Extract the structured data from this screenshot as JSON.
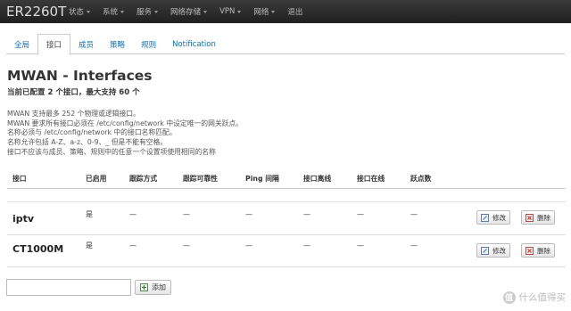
{
  "app": {
    "brand": "ER2260T",
    "menu": [
      "状态",
      "系统",
      "服务",
      "网络存储",
      "VPN",
      "网络",
      "退出"
    ]
  },
  "tabs": [
    {
      "label": "全局",
      "active": false
    },
    {
      "label": "接口",
      "active": true
    },
    {
      "label": "成员",
      "active": false
    },
    {
      "label": "策略",
      "active": false
    },
    {
      "label": "规则",
      "active": false
    },
    {
      "label": "Notification",
      "active": false
    }
  ],
  "page": {
    "title": "MWAN - Interfaces",
    "subtitle": "当前已配置 2 个接口，最大支持 60 个",
    "description": [
      "MWAN 支持最多 252 个物理或逻辑接口。",
      "MWAN 要求所有接口必须在 /etc/config/network 中设定唯一的网关跃点。",
      "名称必须与 /etc/config/network 中的接口名称匹配。",
      "名称允许包括 A-Z、a-z、0-9、_ 但是不能有空格。",
      "接口不应该与成员、策略、规则中的任意一个设置项使用相同的名称"
    ]
  },
  "table": {
    "headers": [
      "接口",
      "已启用",
      "跟踪方式",
      "跟踪可靠性",
      "Ping 间隔",
      "接口离线",
      "接口在线",
      "跃点数"
    ],
    "rows": [
      {
        "name": "iptv",
        "enabled": "是",
        "track_method": "—",
        "reliability": "—",
        "ping_interval": "—",
        "down": "—",
        "up": "—",
        "metric": "—"
      },
      {
        "name": "CT1000M",
        "enabled": "是",
        "track_method": "—",
        "reliability": "—",
        "ping_interval": "—",
        "down": "—",
        "up": "—",
        "metric": "—"
      }
    ],
    "edit_label": "修改",
    "delete_label": "删除"
  },
  "add": {
    "input_value": "",
    "button_label": "添加"
  },
  "watermark": {
    "logo": "值",
    "text": "什么值得买"
  }
}
